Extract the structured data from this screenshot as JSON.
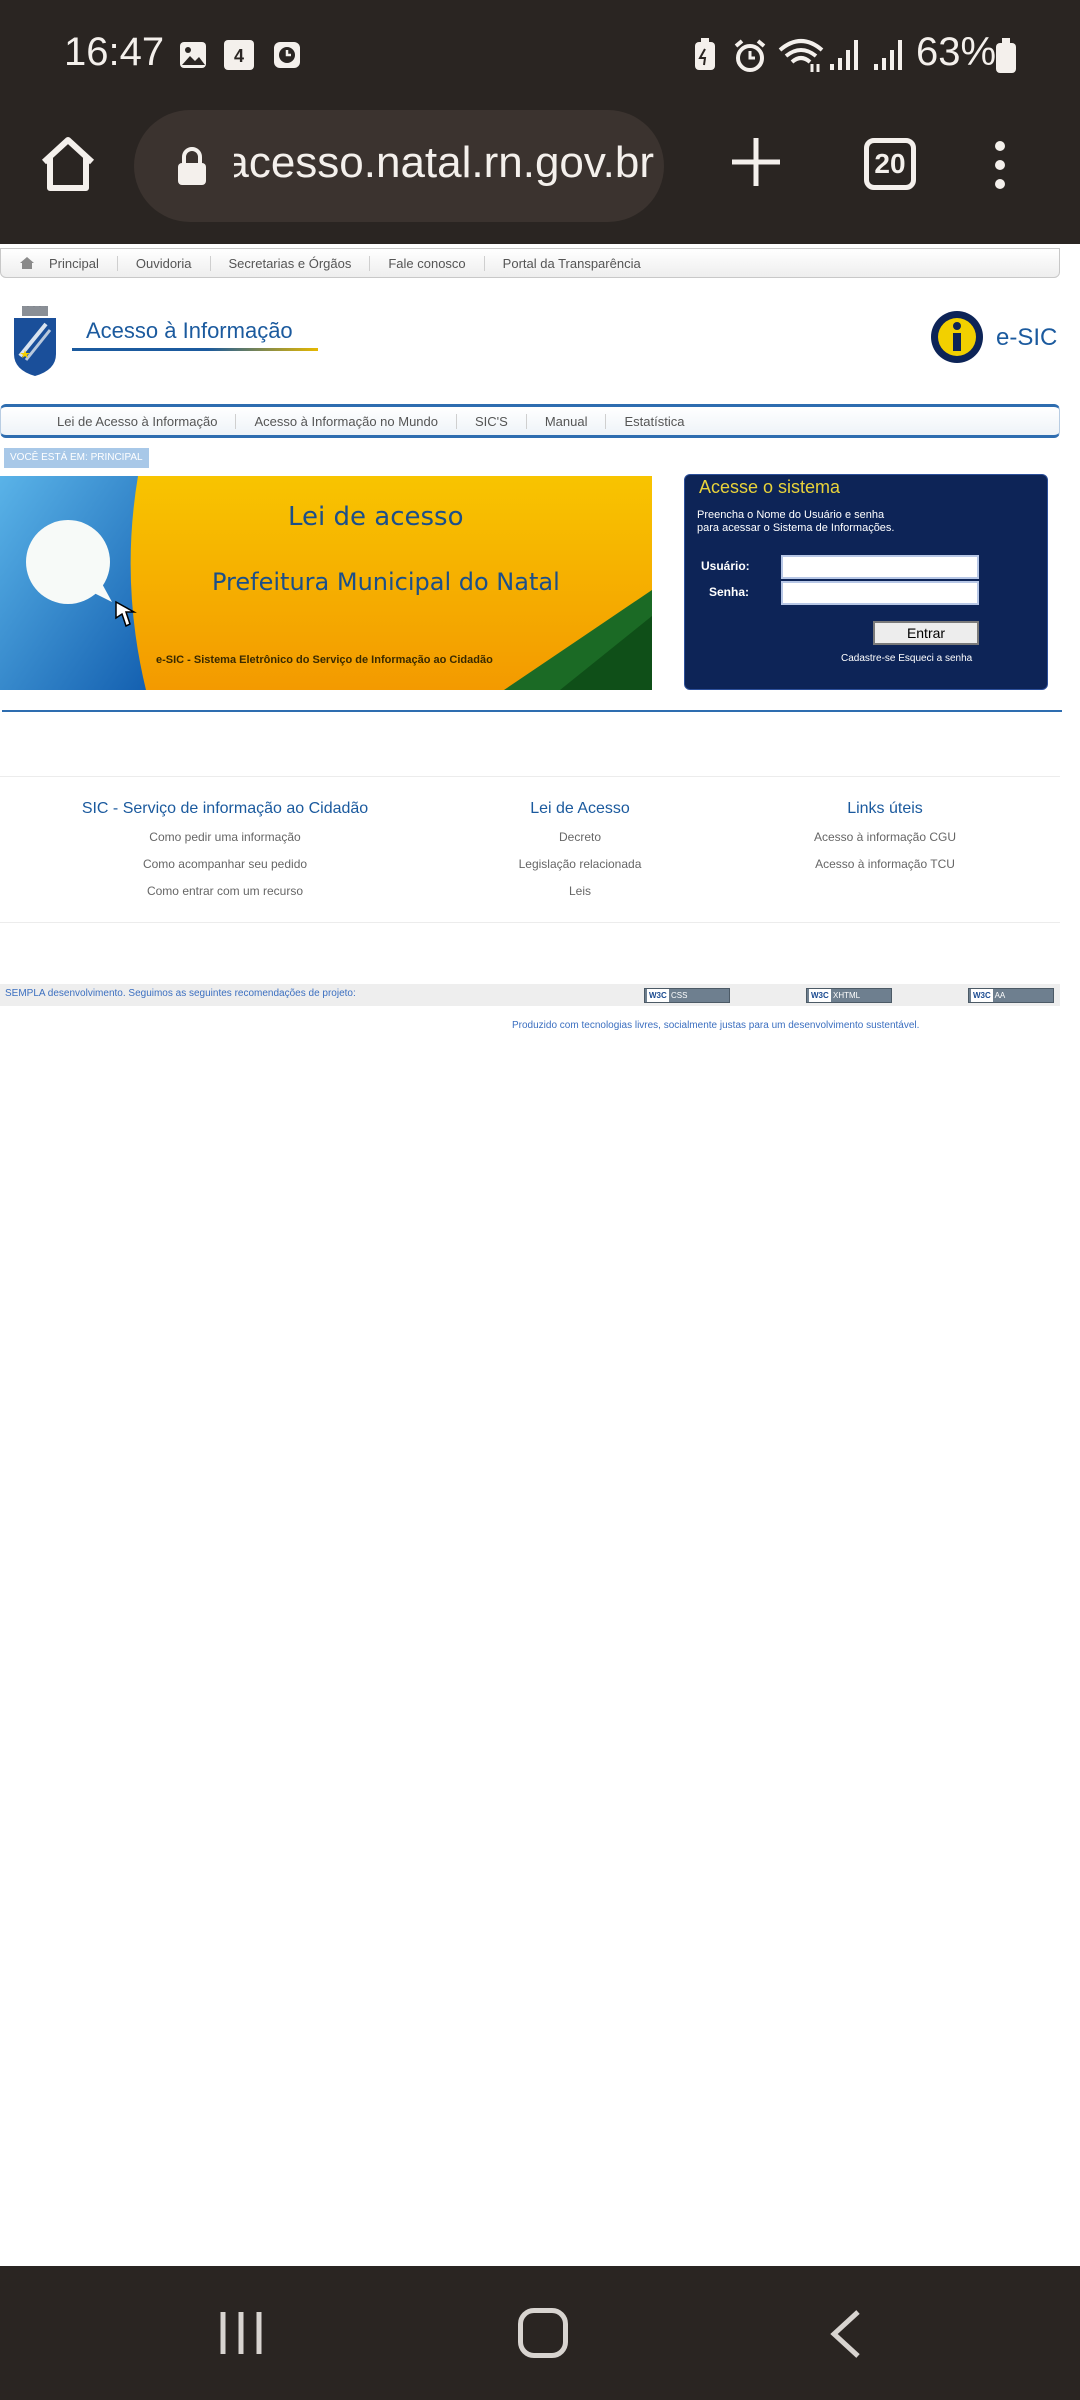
{
  "status_bar": {
    "time": "16:47",
    "notification_icons": [
      "gallery-icon",
      "calendar-icon",
      "clock-icon"
    ],
    "calendar_day": "4",
    "system_icons": [
      "battery-saver-icon",
      "alarm-icon",
      "wifi-icon",
      "signal-icon",
      "signal-icon"
    ],
    "battery_percent": "63%"
  },
  "browser": {
    "url": "acesso.natal.rn.gov.br",
    "tab_count": "20"
  },
  "site": {
    "top_nav": [
      "Principal",
      "Ouvidoria",
      "Secretarias e Órgãos",
      "Fale conosco",
      "Portal da Transparência"
    ],
    "brand_title": "Acesso à Informação",
    "esic_label": "e-SIC",
    "main_nav": [
      "Lei de Acesso à Informação",
      "Acesso à Informação no Mundo",
      "SIC'S",
      "Manual",
      "Estatística"
    ],
    "breadcrumb": "VOCÊ ESTÁ EM: PRINCIPAL",
    "banner": {
      "title": "Lei de acesso",
      "subtitle": "Prefeitura Municipal do Natal",
      "caption": "e-SIC - Sistema Eletrônico do Serviço de Informação ao Cidadão"
    },
    "login": {
      "title": "Acesse o sistema",
      "description": "Preencha o Nome do Usuário e senha para acessar o Sistema de Informações.",
      "user_label": "Usuário:",
      "password_label": "Senha:",
      "submit_label": "Entrar",
      "register_link": "Cadastre-se",
      "forgot_link": "Esqueci a senha"
    },
    "footer_columns": [
      {
        "title": "SIC - Serviço de informação ao Cidadão",
        "links": [
          "Como pedir uma informação",
          "Como acompanhar seu pedido",
          "Como entrar com um recurso"
        ]
      },
      {
        "title": "Lei de Acesso",
        "links": [
          "Decreto",
          "Legislação relacionada",
          "Leis"
        ]
      },
      {
        "title": "Links úteis",
        "links": [
          "Acesso à informação CGU",
          "Acesso à informação TCU"
        ]
      }
    ],
    "footer_bar_text": "SEMPLA desenvolvimento. Seguimos as seguintes recomendações de projeto:",
    "w3c_badges": [
      "CSS",
      "XHTML",
      "AA"
    ],
    "footer_note": "Produzido com tecnologias livres, socialmente justas para um desenvolvimento sustentável."
  },
  "colors": {
    "chrome_dark": "#2a2522",
    "link_blue": "#1b5a9e",
    "login_bg": "#0d2457",
    "login_title": "#e8d23a"
  }
}
